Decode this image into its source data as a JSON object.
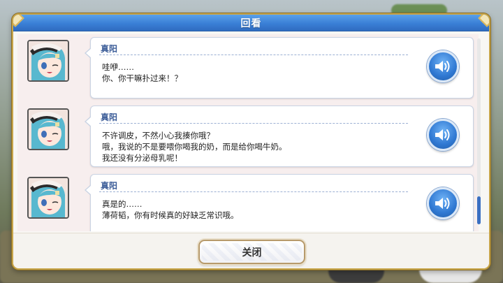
{
  "dialog": {
    "title": "回看"
  },
  "entries": [
    {
      "speaker": "真阳",
      "lines": [
        "哇咿……",
        "你、你干嘛扑过来！？"
      ]
    },
    {
      "speaker": "真阳",
      "lines": [
        "不许调皮，不然小心我揍你哦？",
        "哦，我说的不是要喂你喝我的奶，而是给你喝牛奶。",
        "我还没有分泌母乳呢！"
      ]
    },
    {
      "speaker": "真阳",
      "lines": [
        "真是的……",
        "薄荷韬，你有时候真的好缺乏常识哦。"
      ]
    }
  ],
  "footer": {
    "close_label": "关闭"
  },
  "colors": {
    "title_bar": "#3a7fd6",
    "frame_gold": "#c7a54a",
    "speaker_text": "#3b5c98",
    "voice_button": "#2f78d2",
    "scroll_thumb": "#3a6fc2"
  },
  "icons": {
    "voice": "speaker-volume-icon"
  }
}
